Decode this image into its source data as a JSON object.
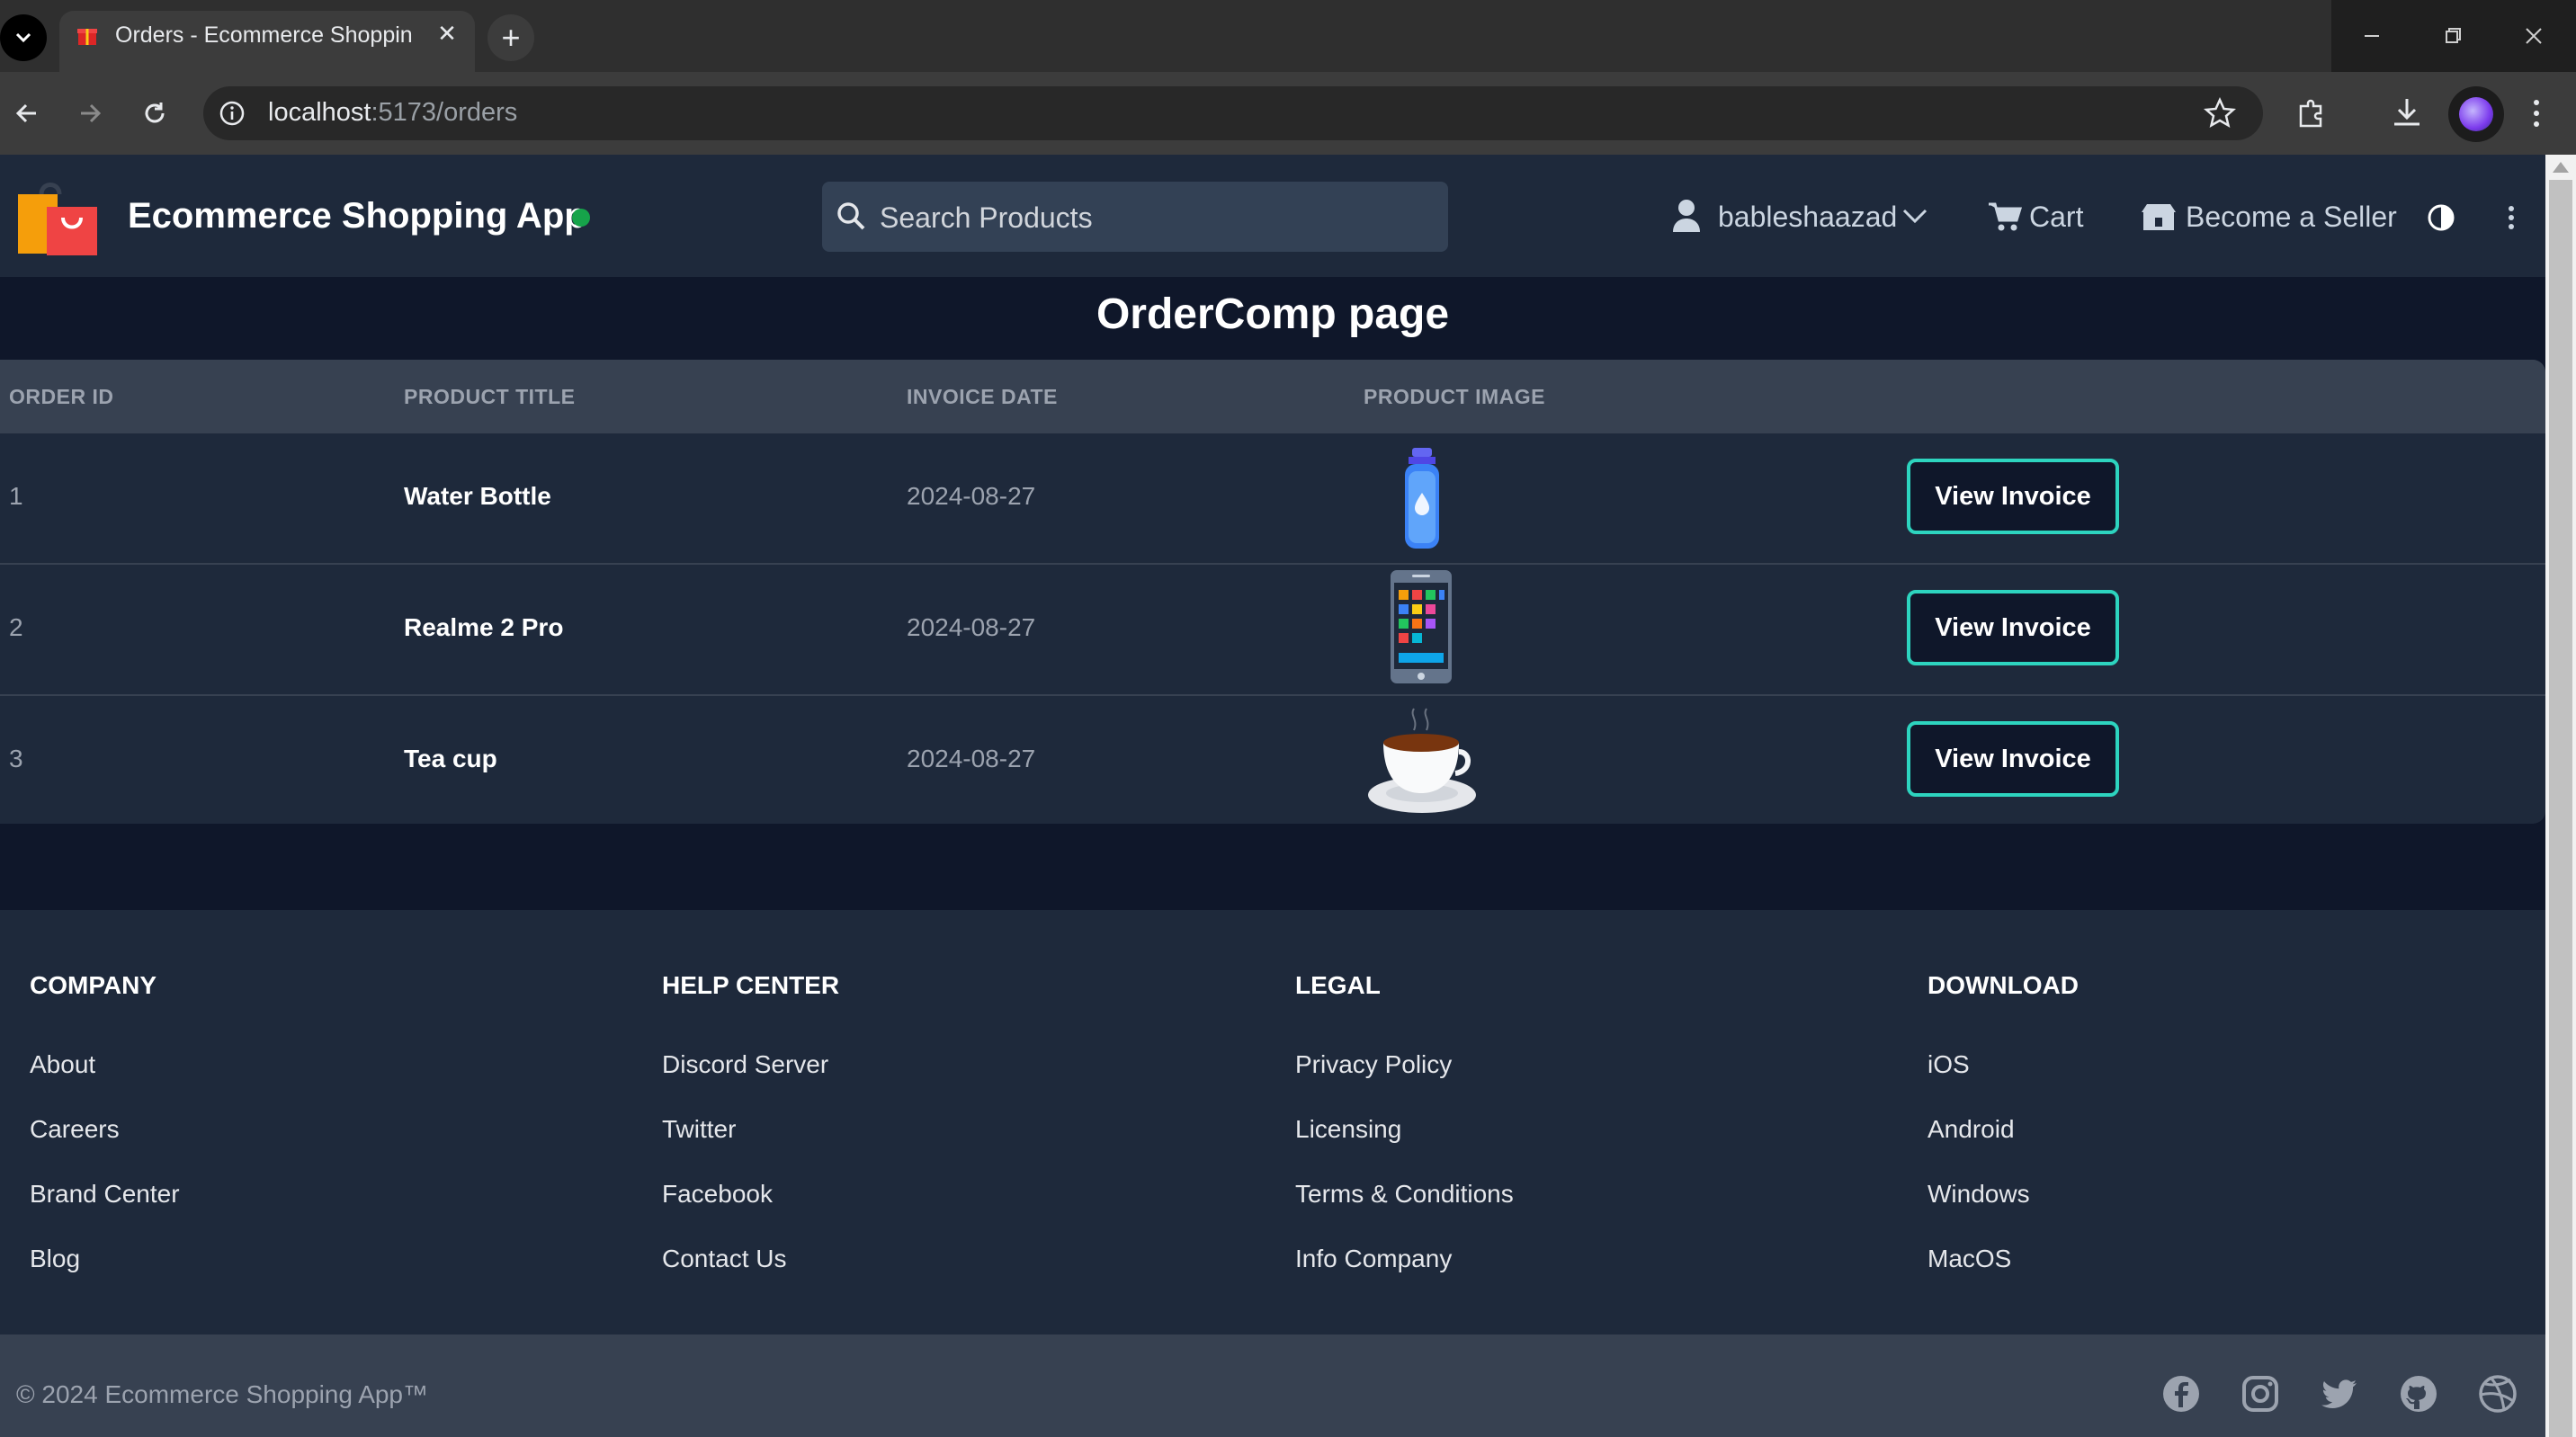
{
  "browser": {
    "tab_title": "Orders - Ecommerce Shopping App",
    "tab_close": "✕",
    "new_tab": "+",
    "url_host": "localhost",
    "url_path": ":5173/orders"
  },
  "header": {
    "app_title": "Ecommerce Shopping App",
    "search_placeholder": "Search Products",
    "user_name": "bableshaazad",
    "cart_label": "Cart",
    "seller_label": "Become a Seller"
  },
  "main": {
    "page_title": "OrderComp page",
    "columns": [
      "ORDER ID",
      "PRODUCT TITLE",
      "INVOICE DATE",
      "PRODUCT IMAGE"
    ],
    "orders": [
      {
        "id": "1",
        "title": "Water Bottle",
        "date": "2024-08-27",
        "image_icon": "water-bottle-icon",
        "action": "View Invoice"
      },
      {
        "id": "2",
        "title": "Realme 2 Pro",
        "date": "2024-08-27",
        "image_icon": "mobile-phone-icon",
        "action": "View Invoice"
      },
      {
        "id": "3",
        "title": "Tea cup",
        "date": "2024-08-27",
        "image_icon": "tea-cup-icon",
        "action": "View Invoice"
      }
    ]
  },
  "footer": {
    "columns": [
      {
        "heading": "COMPANY",
        "links": [
          "About",
          "Careers",
          "Brand Center",
          "Blog"
        ]
      },
      {
        "heading": "HELP CENTER",
        "links": [
          "Discord Server",
          "Twitter",
          "Facebook",
          "Contact Us"
        ]
      },
      {
        "heading": "LEGAL",
        "links": [
          "Privacy Policy",
          "Licensing",
          "Terms & Conditions",
          "Info Company"
        ]
      },
      {
        "heading": "DOWNLOAD",
        "links": [
          "iOS",
          "Android",
          "Windows",
          "MacOS"
        ]
      }
    ],
    "copyright": "© 2024 Ecommerce Shopping App™",
    "social_icons": [
      "facebook-icon",
      "instagram-icon",
      "twitter-icon",
      "github-icon",
      "dribbble-icon"
    ]
  },
  "colors": {
    "header_bg": "#1e293b",
    "page_bg": "#0f172a",
    "accent_button_border": "#2dd4bf",
    "online_indicator": "#16a34a"
  }
}
